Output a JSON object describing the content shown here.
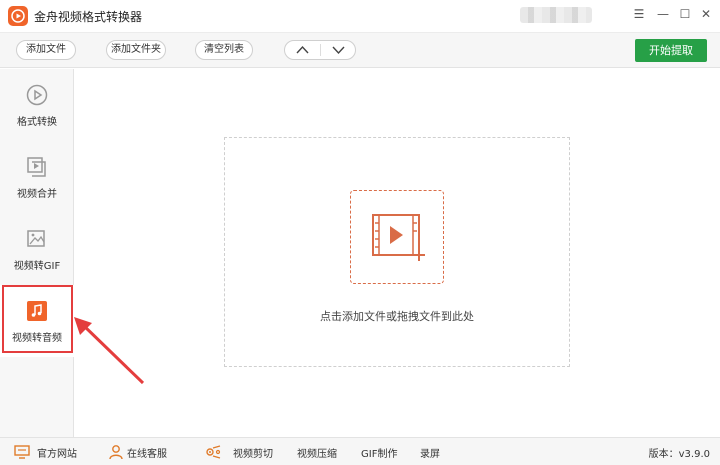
{
  "window": {
    "title": "金舟视频格式转换器",
    "controls": {
      "menu": "☰",
      "minimize": "—",
      "maximize": "☐",
      "close": "✕"
    }
  },
  "toolbar": {
    "add_file": "添加文件",
    "add_folder": "添加文件夹",
    "clear_list": "清空列表",
    "move_up": "∧",
    "move_down": "∨",
    "start": "开始提取"
  },
  "sidebar": {
    "items": [
      {
        "label": "格式转换",
        "icon": "play-circle-icon",
        "active": false
      },
      {
        "label": "视频合并",
        "icon": "video-merge-icon",
        "active": false
      },
      {
        "label": "视频转GIF",
        "icon": "image-gif-icon",
        "active": false
      },
      {
        "label": "视频转音频",
        "icon": "music-note-icon",
        "active": true
      }
    ]
  },
  "main": {
    "drop_hint": "点击添加文件或拖拽文件到此处"
  },
  "statusbar": {
    "website": "官方网站",
    "support": "在线客服",
    "tools": [
      "视频剪切",
      "视频压缩",
      "GIF制作",
      "录屏"
    ],
    "version": "版本：v3.9.0"
  },
  "colors": {
    "brand": "#f0642a",
    "start_button": "#27a047",
    "highlight": "#e43d3d",
    "drop_icon": "#d96c47"
  }
}
